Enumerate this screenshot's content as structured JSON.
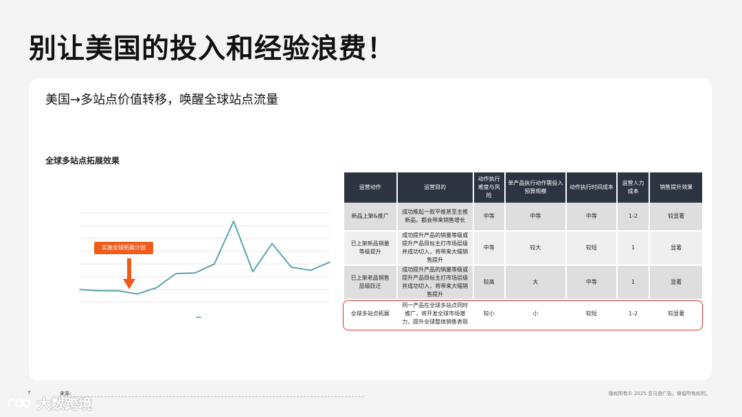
{
  "slide": {
    "title": "别让美国的投入和经验浪费！",
    "subtitle": "美国→多站点价值转移，唤醒全球站点流量",
    "chart_title": "全球多站点拓展效果",
    "callout": "实施全球拓展计划",
    "page_number": "7",
    "source_label": "来源:",
    "copyright": "版权所有© 2025 亚马逊广告。保留所有权利。",
    "watermark": "大数跨境"
  },
  "table": {
    "headers": [
      "运营动作",
      "运营目的",
      "动作执行难度与风险",
      "单产品执行动作需投入预算规模",
      "动作执行时间成本",
      "运营人力成本",
      "销售提升效果"
    ],
    "rows": [
      [
        "新品上架&推广",
        "成功推起一款平推甚至主推新品，都会带来销售增长",
        "中等",
        "中等",
        "中等",
        "1-2",
        "较显著"
      ],
      [
        "已上架新品销量等级提升",
        "成功提升产品的销量等级或提升产品目标主打市场层级并成功切入，将带来大幅销售提升",
        "中等",
        "较大",
        "较短",
        "1",
        "显著"
      ],
      [
        "已上架老品销售层级跃迁",
        "成功提升产品的销量等级或提升产品目标主打市场层级并成功切入，将带来大幅销售提升",
        "较高",
        "大",
        "中等",
        "1",
        "显著"
      ],
      [
        "全球多站点拓展",
        "同一产品在全球多站点同时推广，将开发全球市场潜力，提升全球整体销售表现",
        "较小",
        "小",
        "较短",
        "1-2",
        "较显著"
      ]
    ]
  },
  "chart_data": {
    "type": "line",
    "title": "全球多站点拓展效果",
    "series": [
      {
        "values": [
          20,
          18,
          18,
          13,
          23,
          45,
          46,
          60,
          127,
          48,
          92,
          55,
          50,
          63
        ],
        "color": "#5aa3a6"
      }
    ],
    "x": [
      1,
      2,
      3,
      4,
      5,
      6,
      7,
      8,
      9,
      10,
      11,
      12,
      13,
      14
    ],
    "ylim": [
      0,
      140
    ],
    "grid": true,
    "annotation": {
      "text": "实施全球拓展计划",
      "at_x": 4
    }
  }
}
